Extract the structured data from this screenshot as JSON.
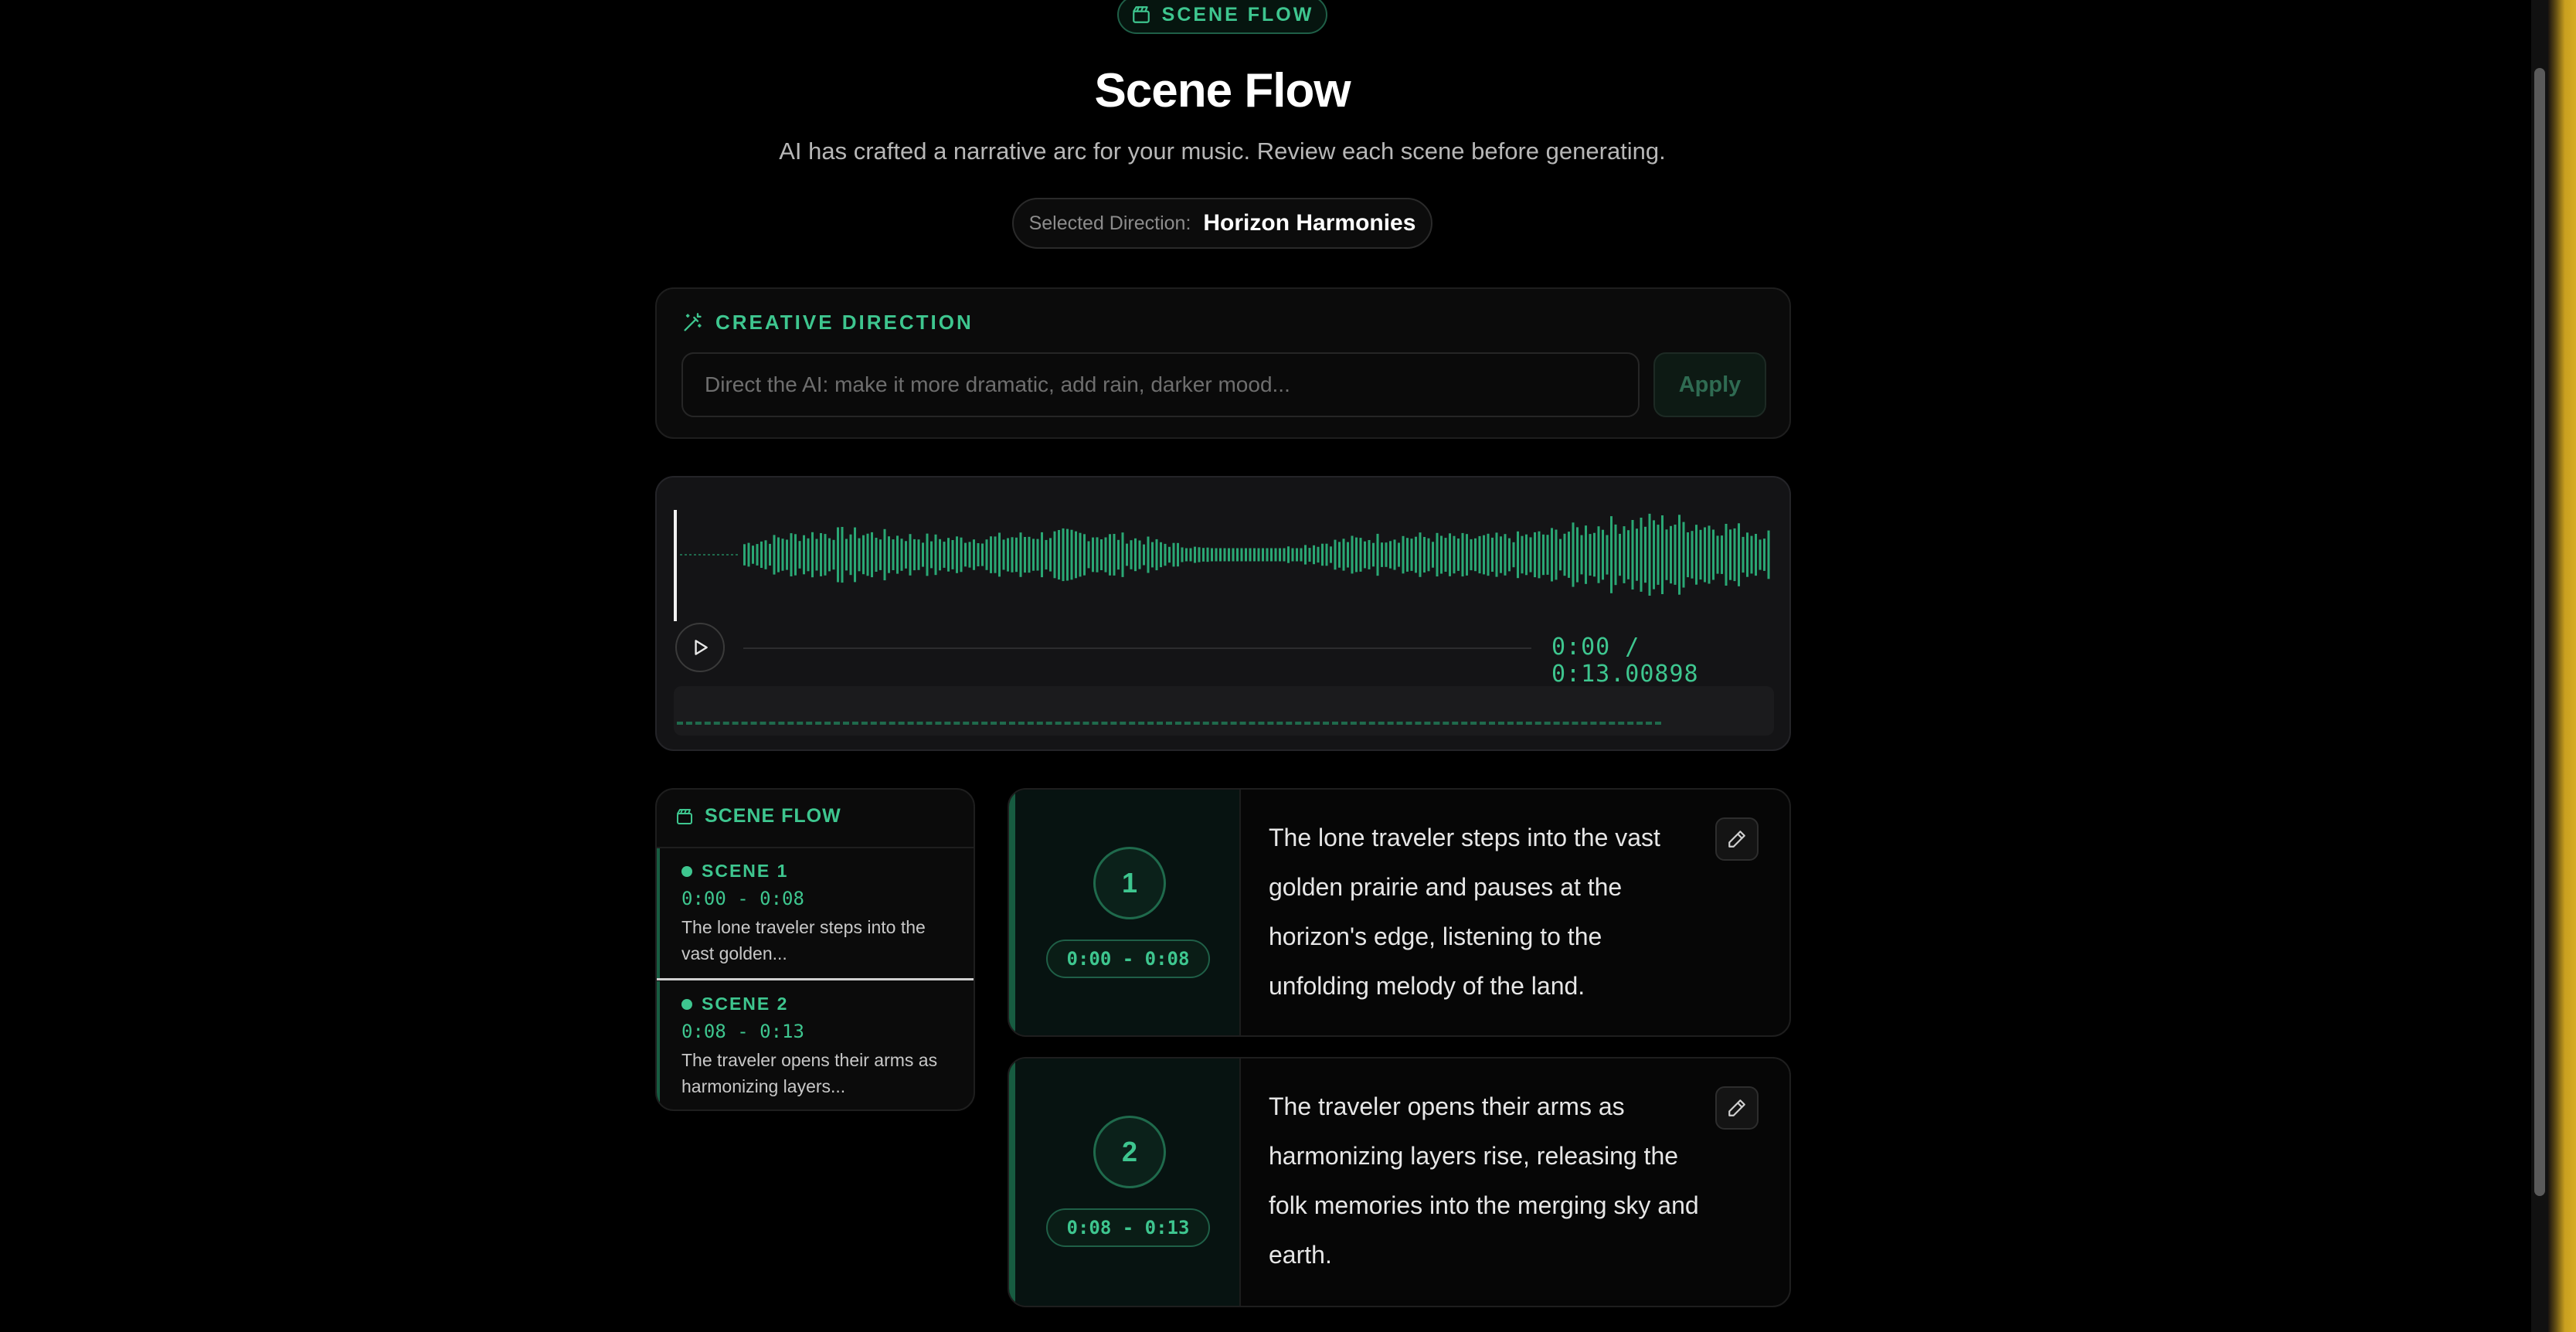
{
  "header": {
    "badge_label": "SCENE FLOW",
    "title": "Scene Flow",
    "subtitle": "AI has crafted a narrative arc for your music. Review each scene before generating.",
    "selected_direction_label": "Selected Direction:",
    "selected_direction_value": "Horizon Harmonies"
  },
  "creative_direction": {
    "heading": "CREATIVE DIRECTION",
    "input_value": "",
    "input_placeholder": "Direct the AI: make it more dramatic, add rain, darker mood...",
    "apply_label": "Apply"
  },
  "player": {
    "time_readout": "0:00 / 0:13.00898",
    "progress_fraction": 0
  },
  "scene_flow_sidebar": {
    "heading": "SCENE FLOW",
    "items": [
      {
        "label": "SCENE 1",
        "time": "0:00 - 0:08",
        "excerpt": "The lone traveler steps into the vast golden..."
      },
      {
        "label": "SCENE 2",
        "time": "0:08 - 0:13",
        "excerpt": "The traveler opens their arms as harmonizing layers..."
      }
    ]
  },
  "scenes": [
    {
      "number": "1",
      "time": "0:00 - 0:08",
      "description": "The lone traveler steps into the vast golden prairie and pauses at the horizon's edge, listening to the unfolding melody of the land."
    },
    {
      "number": "2",
      "time": "0:08 - 0:13",
      "description": "The traveler opens their arms as harmonizing layers rise, releasing the folk memories into the merging sky and earth."
    }
  ],
  "colors": {
    "accent": "#3ec68f",
    "accent_dark": "#175c41",
    "background": "#000000",
    "card": "#0b0b0b"
  },
  "icons": {
    "badge": "clapperboard-icon",
    "creative_direction": "magic-wand-icon",
    "play": "play-icon",
    "edit": "pencil-icon"
  }
}
